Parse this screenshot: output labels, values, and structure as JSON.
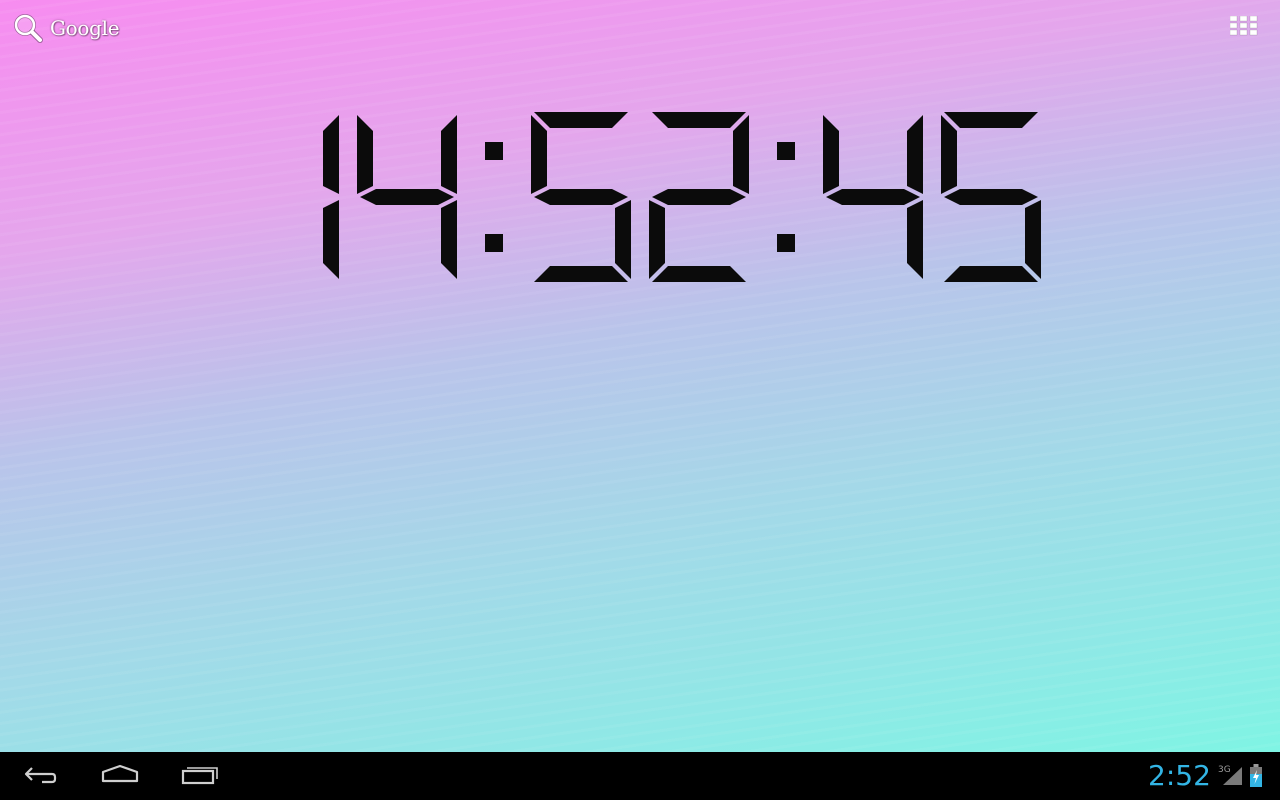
{
  "search": {
    "label": "Google"
  },
  "clock": {
    "time": "14:52:45",
    "digit_color": "#0b0b0b"
  },
  "status_bar": {
    "time": "2:52",
    "network": "3G",
    "time_color": "#33b5e5"
  },
  "navigation": {
    "icons": [
      "back-icon",
      "home-icon",
      "recent-apps-icon"
    ]
  },
  "icons": {
    "search": "search-icon",
    "apps": "apps-grid-icon",
    "signal": "signal-icon",
    "battery": "battery-charging-icon"
  }
}
